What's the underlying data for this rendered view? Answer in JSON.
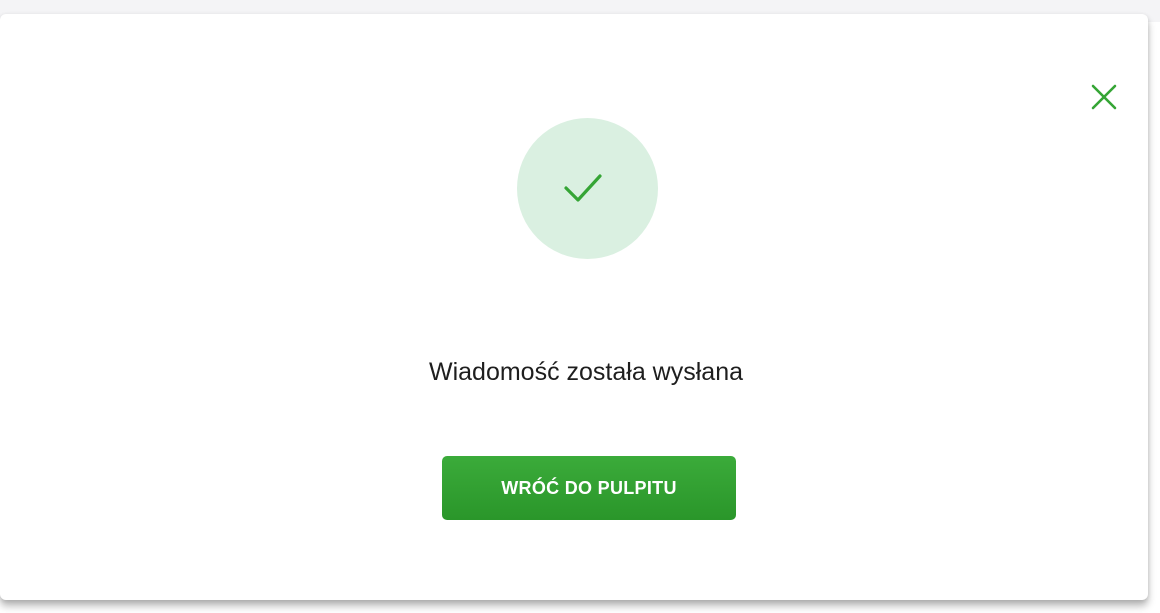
{
  "modal": {
    "message": "Wiadomość została wysłana",
    "back_button_label": "WRÓĆ DO PULPITU",
    "close_icon": "close-icon",
    "status_icon": "checkmark-icon"
  },
  "colors": {
    "accent": "#35a535",
    "success_circle_bg": "#daf0e1",
    "text": "#1e1e1e"
  }
}
